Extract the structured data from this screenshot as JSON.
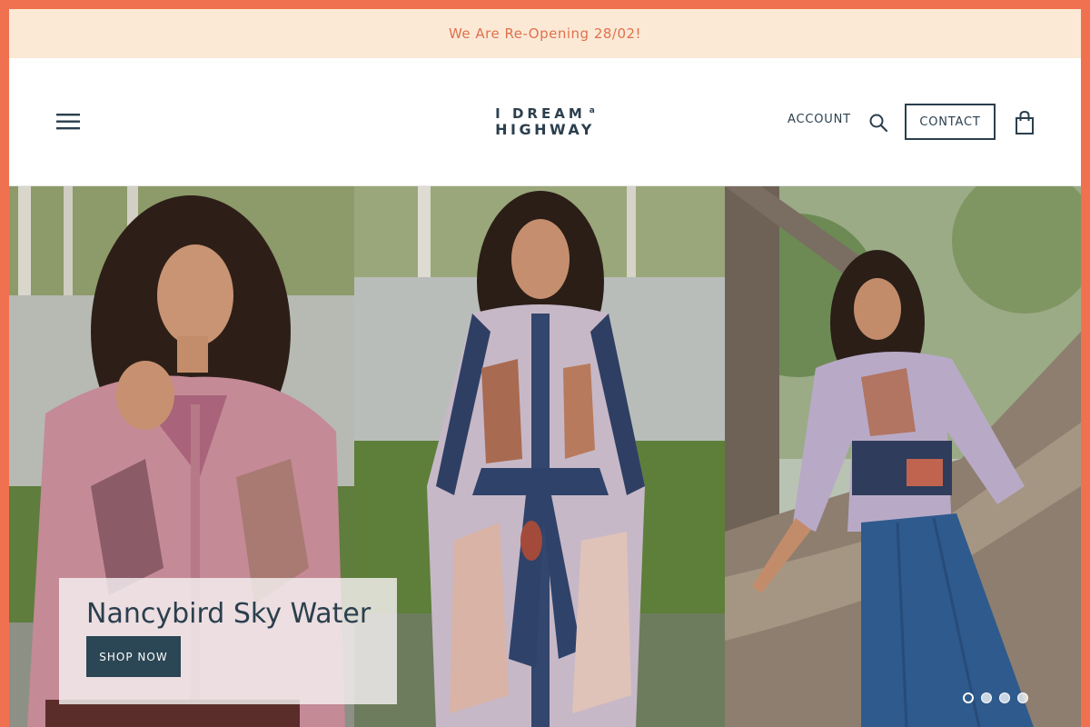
{
  "announcement": {
    "text": "We Are Re-Opening 28/02!"
  },
  "header": {
    "menu_icon": "hamburger-menu-icon",
    "logo": {
      "line1": "I DREAM",
      "line1_small": "a",
      "line2": "HIGHWAY"
    },
    "account_label": "ACCOUNT",
    "search_icon": "search-icon",
    "contact_label": "CONTACT",
    "cart_icon": "shopping-bag-icon"
  },
  "hero": {
    "slide_title": "Nancybird Sky Water",
    "cta_label": "SHOP NOW",
    "slide_count": 4,
    "active_slide": 1
  },
  "colors": {
    "frame": "#f0714f",
    "announcement_bg": "#fbe9d6",
    "announcement_text": "#e0704c",
    "brand_navy": "#2b3f4d",
    "button_bg": "#2b4654"
  }
}
